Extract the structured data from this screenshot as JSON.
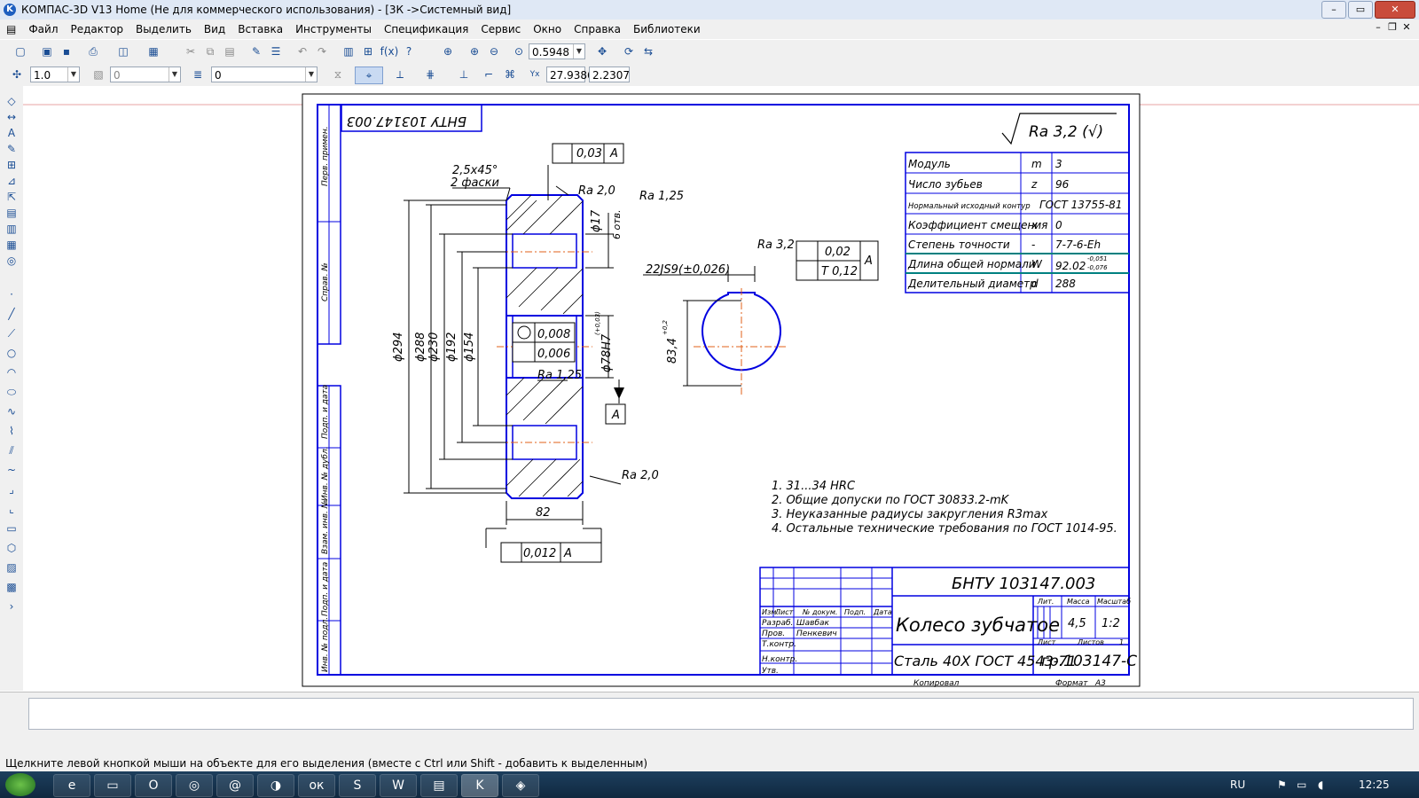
{
  "window": {
    "title": "КОМПАС-3D V13 Home (Не для коммерческого использования) - [3К ->Системный вид]",
    "app_icon_letter": "K"
  },
  "menu": [
    "Файл",
    "Редактор",
    "Выделить",
    "Вид",
    "Вставка",
    "Инструменты",
    "Спецификация",
    "Сервис",
    "Окно",
    "Справка",
    "Библиотеки"
  ],
  "toolbar": {
    "zoom_value": "0.5948",
    "step_value": "1.0",
    "layer_value": "0",
    "style_value": "0",
    "coord_x": "27.9386",
    "coord_y": "2.2307",
    "fx_label": "f(x)"
  },
  "drawing": {
    "doc_code_rotated": "БНТУ 103147.003",
    "stamp_code": "БНТУ 103147.003",
    "part_name": "Колесо зубчатое",
    "material": "Сталь 40Х ГОСТ 4543-71",
    "group": "гр.103147-С",
    "roughness_general": "Ra 3,2 (√)",
    "mass": "4,5",
    "scale": "1:2",
    "sheets_label": "Листов",
    "sheets_value": "1",
    "sheet_label": "Лист",
    "lit_label": "Лит.",
    "mass_label": "Масса",
    "scale_label": "Масштаб",
    "copied_label": "Копировал",
    "format_label": "Формат",
    "format_value": "A3",
    "stamp_rows": [
      "Изм.",
      "Лист",
      "№ докум.",
      "Подп.",
      "Дата"
    ],
    "people": [
      {
        "role": "Разраб.",
        "name": "Шавбак"
      },
      {
        "role": "Пров.",
        "name": "Пенкевич"
      },
      {
        "role": "Т.контр.",
        "name": ""
      },
      {
        "role": "Н.контр.",
        "name": ""
      },
      {
        "role": "Утв.",
        "name": ""
      }
    ],
    "side_labels": [
      "Перв. примен.",
      "Справ. №",
      "Подп. и дата",
      "Инв. № дубл.",
      "Взам. инв. №",
      "Подп. и дата",
      "Инв. № подл."
    ],
    "params_table": [
      {
        "name": "Модуль",
        "symbol": "m",
        "value": "3"
      },
      {
        "name": "Число зубьев",
        "symbol": "z",
        "value": "96"
      },
      {
        "name": "Нормальный исходный контур",
        "symbol": "",
        "value": "ГОСТ 13755-81"
      },
      {
        "name": "Коэффициент смещения",
        "symbol": "x",
        "value": "0"
      },
      {
        "name": "Степень точности",
        "symbol": "-",
        "value": "7-7-6-Eh"
      },
      {
        "name": "Длина общей нормали",
        "symbol": "W",
        "value": "92.02"
      },
      {
        "name": "Делительный диаметр",
        "symbol": "d",
        "value": "288"
      }
    ],
    "notes": [
      "1.  31...34  HRC",
      "2.  Общие допуски по ГОСТ 30833.2-mK",
      "3.  Неуказанные радиусы закругления R3max",
      "4.  Остальные технические требования по ГОСТ 1014-95."
    ],
    "dims": {
      "d294": "ϕ294",
      "d288": "ϕ288",
      "d230": "ϕ230",
      "d192": "ϕ192",
      "d154": "ϕ154",
      "d78": "ϕ78H7",
      "d78tol": "(+0,03)",
      "d17": "ϕ17",
      "holes": "6 отв.",
      "width": "82",
      "chamfer": "2,5x45°",
      "chamfer_note": "2 фаски",
      "keyway": "22JS9(±0,026)",
      "keydepth": "83,4",
      "keydepth_tol": "+0,2",
      "ra20": "Ra 2,0",
      "ra125": "Ra 1,25",
      "ra32": "Ra 3,2",
      "tol003": "0,03",
      "tol0012": "0,012",
      "tol0008": "0,008",
      "tol0006": "0,006",
      "tol002": "0,02",
      "tol012": "T 0,12",
      "base": "A",
      "w_tol_up": "-0,051",
      "w_tol_dn": "-0,076"
    }
  },
  "status": {
    "hint": "Щелкните левой кнопкой мыши на объекте для его выделения (вместе с Ctrl или Shift - добавить к выделенным)"
  },
  "taskbar": {
    "lang": "RU",
    "time": "12:25"
  }
}
